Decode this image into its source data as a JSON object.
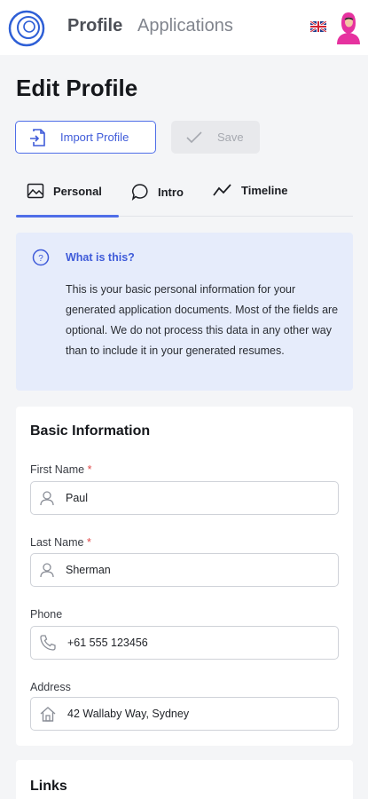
{
  "header": {
    "nav_profile": "Profile",
    "nav_applications": "Applications",
    "language_flag": "uk-flag-icon",
    "avatar_icon": "user-avatar"
  },
  "page": {
    "title": "Edit Profile"
  },
  "actions": {
    "import_label": "Import Profile",
    "save_label": "Save",
    "save_disabled": true
  },
  "tabs": [
    {
      "label": "Personal",
      "icon": "image-icon",
      "active": true
    },
    {
      "label": "Intro",
      "icon": "chat-bubble-icon",
      "active": false
    },
    {
      "label": "Timeline",
      "icon": "trend-line-icon",
      "active": false
    }
  ],
  "info": {
    "title": "What is this?",
    "text": "This is your basic personal information for your generated application documents. Most of the fields are optional. We do not process this data in any other way than to include it in your generated resumes."
  },
  "basic_info": {
    "title": "Basic Information",
    "fields": [
      {
        "label": "First Name",
        "required": true,
        "value": "Paul",
        "icon": "person-icon"
      },
      {
        "label": "Last Name",
        "required": true,
        "value": "Sherman",
        "icon": "person-icon"
      },
      {
        "label": "Phone",
        "required": false,
        "value": "+61 555 123456",
        "icon": "phone-icon"
      },
      {
        "label": "Address",
        "required": false,
        "value": "42 Wallaby Way, Sydney",
        "icon": "home-icon"
      }
    ]
  },
  "links": {
    "title": "Links"
  },
  "colors": {
    "accent": "#4f6ee8",
    "info_bg": "#e6ecfb",
    "required": "#e04a4a"
  }
}
